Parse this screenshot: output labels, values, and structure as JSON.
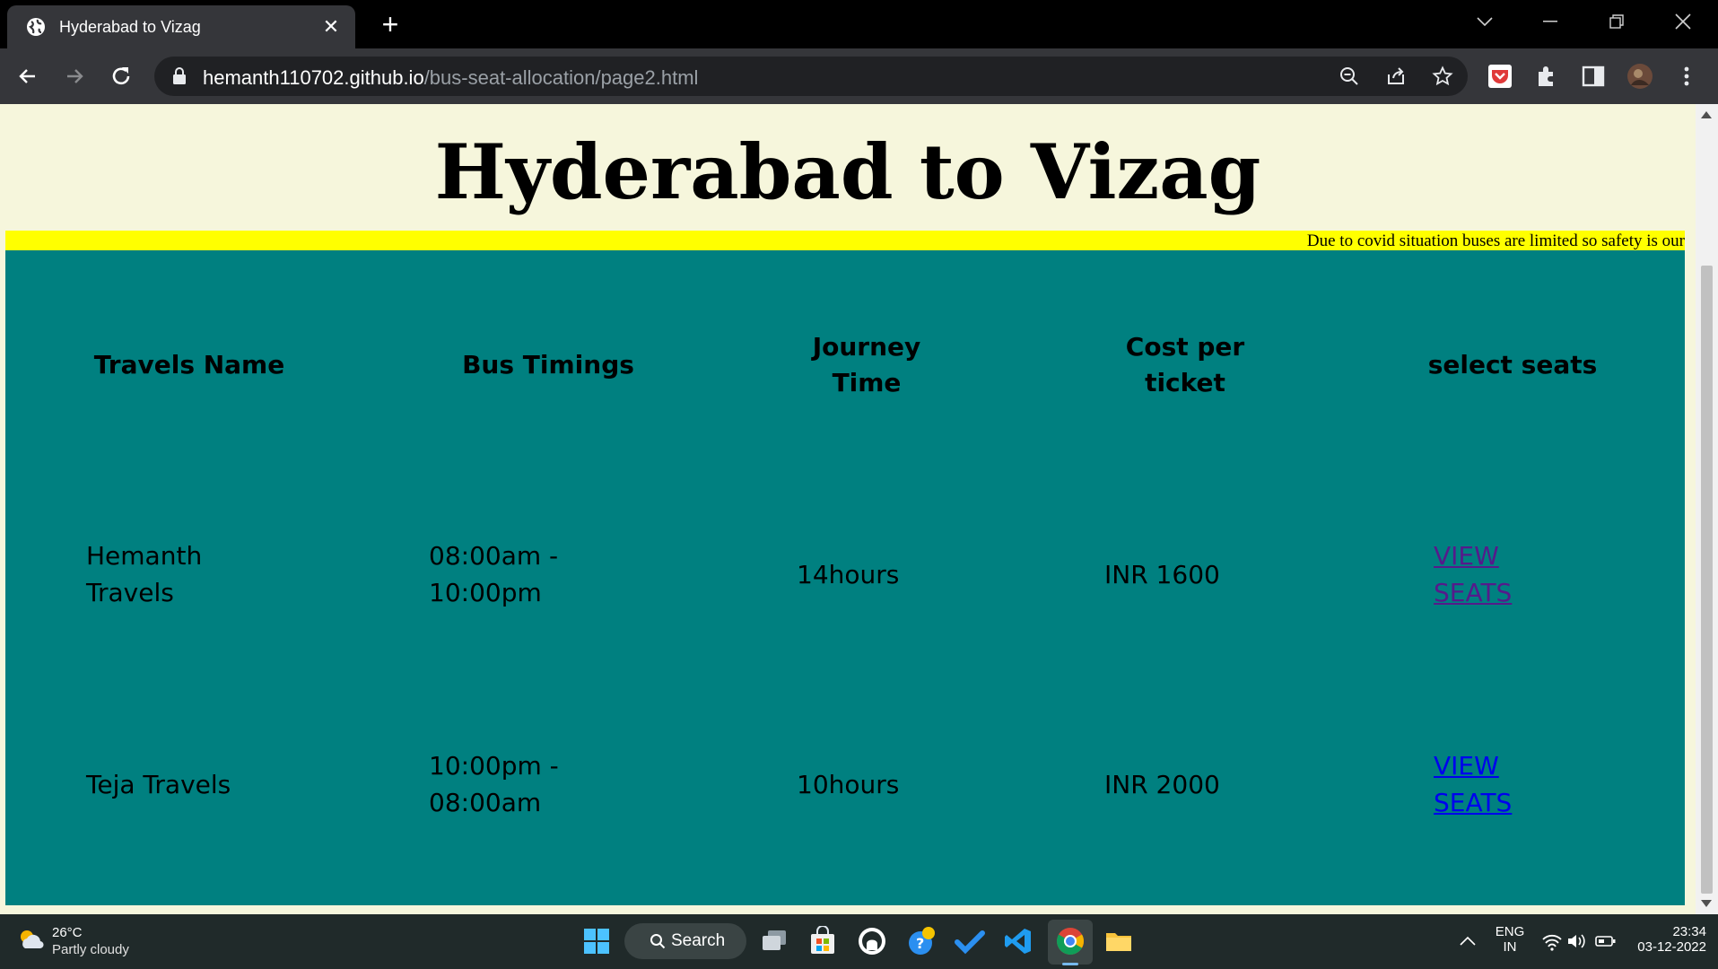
{
  "browser": {
    "tab_title": "Hyderabad to Vizag",
    "url_host": "hemanth110702.github.io",
    "url_path": "/bus-seat-allocation/page2.html"
  },
  "page": {
    "title": "Hyderabad to Vizag",
    "marquee": "Due to covid situation buses are limited so safety is our",
    "table": {
      "headers": {
        "travels_name": "Travels Name",
        "bus_timings": "Bus Timings",
        "journey_time_line1": "Journey",
        "journey_time_line2": "Time",
        "cost_line1": "Cost per",
        "cost_line2": "ticket",
        "select_seats": "select seats"
      },
      "rows": [
        {
          "name_line1": "Hemanth",
          "name_line2": "Travels",
          "timing_line1": "08:00am -",
          "timing_line2": "10:00pm",
          "journey": "14hours",
          "cost": "INR 1600",
          "link_line1": "VIEW",
          "link_line2": "SEATS"
        },
        {
          "name": "Teja Travels",
          "timing_line1": "10:00pm -",
          "timing_line2": "08:00am",
          "journey": "10hours",
          "cost": "INR 2000",
          "link_line1": "VIEW",
          "link_line2": "SEATS"
        }
      ]
    }
  },
  "taskbar": {
    "weather_temp": "26°C",
    "weather_desc": "Partly cloudy",
    "search_label": "Search",
    "lang_line1": "ENG",
    "lang_line2": "IN",
    "time": "23:34",
    "date": "03-12-2022"
  },
  "colors": {
    "page_bg": "#f6f6dc",
    "panel_bg": "#008080",
    "marquee_bg": "#ffff00",
    "link": "#0000ee",
    "link_visited": "#551a8b"
  }
}
